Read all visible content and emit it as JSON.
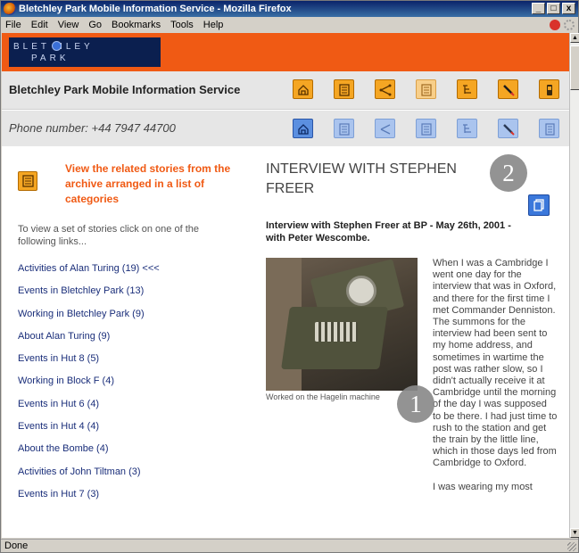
{
  "window": {
    "title": "Bletchley Park Mobile Information Service - Mozilla Firefox",
    "controls": [
      "_",
      "□",
      "x"
    ]
  },
  "menu": [
    "File",
    "Edit",
    "View",
    "Go",
    "Bookmarks",
    "Tools",
    "Help"
  ],
  "status": "Done",
  "site": {
    "logo_line1": "BLET  HLEY",
    "logo_line2": "PARK",
    "service_title": "Bletchley Park Mobile Information Service",
    "phone": "Phone number: +44 7947 44700",
    "accent": "#f05a14",
    "nav_color": "#1a2e7a"
  },
  "left": {
    "related_heading": "View the related stories from the archive arranged in a list of categories",
    "hint": "To view a set of stories click on one of the following links...",
    "categories": [
      "Activities of Alan Turing (19) <<<",
      "Events in Bletchley Park (13)",
      "Working in Bletchley Park (9)",
      "About Alan Turing (9)",
      "Events in Hut 8 (5)",
      "Working in Block F (4)",
      "Events in Hut 6 (4)",
      "Events in Hut 4 (4)",
      "About the Bombe (4)",
      "Activities of John Tiltman (3)",
      "Events in Hut 7 (3)"
    ]
  },
  "article": {
    "title": "Interview with Stephen Freer",
    "subtitle": "Interview with Stephen Freer at BP - May 26th, 2001 - with Peter Wescombe.",
    "caption": "Worked on the Hagelin machine",
    "para1": "When I was a Cambridge I went one day for the interview that was in Oxford, and there for the first time I met Commander Denniston. The summons for the interview had been sent to my home address, and sometimes in wartime the post was rather slow, so I didn't actually receive it at Cambridge until the morning of the day I was supposed to be there. I had just time to rush to the station and get the train by the little line, which in those days led from Cambridge to Oxford.",
    "para2": "I was wearing my most"
  },
  "badges": [
    "1",
    "2"
  ]
}
